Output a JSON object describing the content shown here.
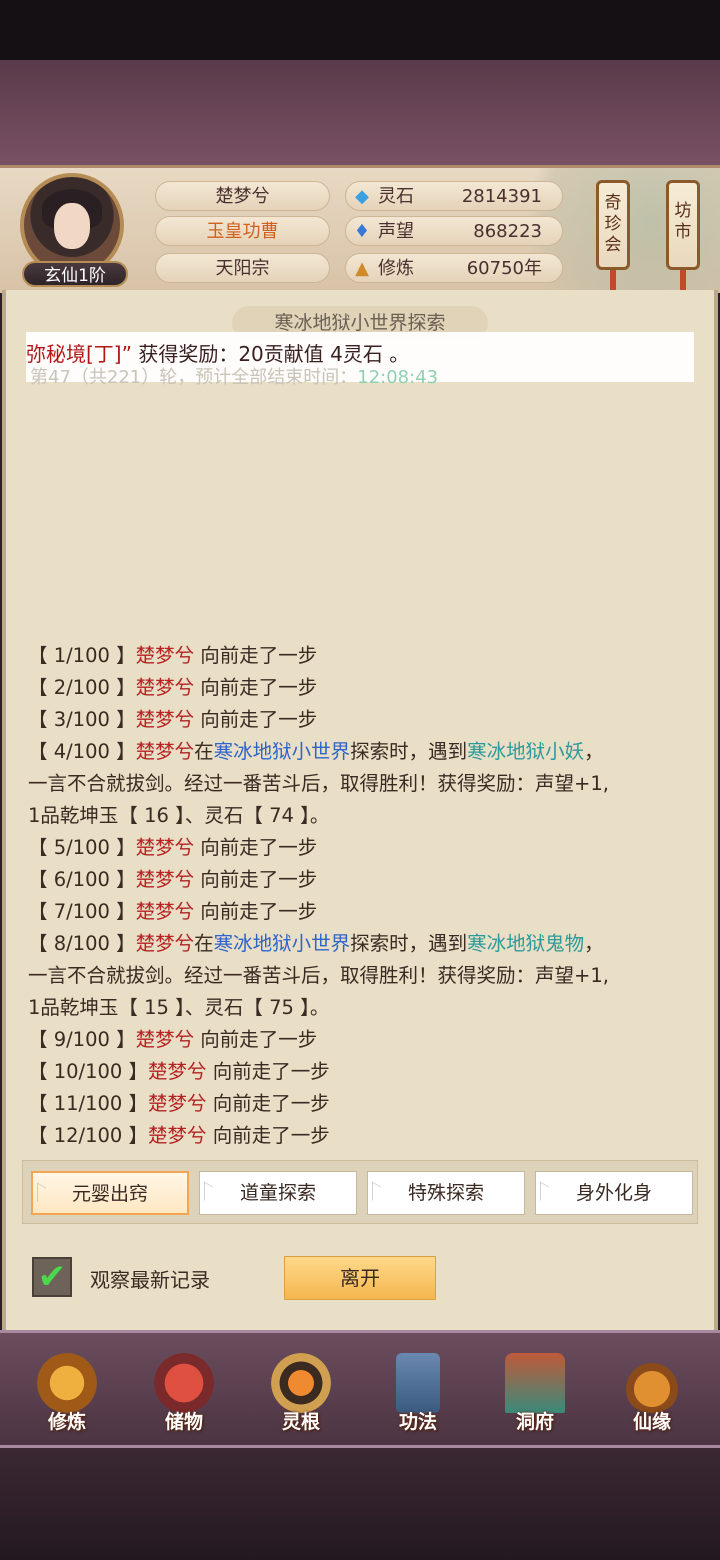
{
  "player": {
    "name": "楚梦兮",
    "title": "玉皇功曹",
    "sect": "天阳宗",
    "rank": "玄仙1阶"
  },
  "resources": [
    {
      "icon": "spirit-stone-icon",
      "label": "灵石",
      "value": "2814391"
    },
    {
      "icon": "reputation-icon",
      "label": "声望",
      "value": "868223"
    },
    {
      "icon": "cultivation-icon",
      "label": "修炼",
      "value": "60750年"
    }
  ],
  "side_buttons": {
    "treasure": "奇珍会",
    "market": "坊市"
  },
  "panel": {
    "title": "寒冰地狱小世界探索",
    "banner_prefix": "弥秘境[丁]”",
    "banner_suffix": " 获得奖励：20贡献值 4灵石 。",
    "round_text": "第47（共221）轮，预计全部结束时间：",
    "round_time": "12:08:43"
  },
  "log": {
    "l1": {
      "step": "【 1/100 】",
      "name": "楚梦兮",
      "action": " 向前走了一步"
    },
    "l2": {
      "step": "【 2/100 】",
      "name": "楚梦兮",
      "action": " 向前走了一步"
    },
    "l3": {
      "step": "【 3/100 】",
      "name": "楚梦兮",
      "action": " 向前走了一步"
    },
    "l4": {
      "step": "【 4/100 】",
      "name": "楚梦兮",
      "mid1": "在",
      "place": "寒冰地狱小世界",
      "mid2": "探索时，遇到",
      "monster": "寒冰地狱小妖",
      "end": "，"
    },
    "l4b": "一言不合就拔剑。经过一番苦斗后，取得胜利！获得奖励：声望+1,",
    "l4c": "1品乾坤玉【 16 】、灵石【 74 】。",
    "l5": {
      "step": "【 5/100 】",
      "name": "楚梦兮",
      "action": " 向前走了一步"
    },
    "l6": {
      "step": "【 6/100 】",
      "name": "楚梦兮",
      "action": " 向前走了一步"
    },
    "l7": {
      "step": "【 7/100 】",
      "name": "楚梦兮",
      "action": " 向前走了一步"
    },
    "l8": {
      "step": "【 8/100 】",
      "name": "楚梦兮",
      "mid1": "在",
      "place": "寒冰地狱小世界",
      "mid2": "探索时，遇到",
      "monster": "寒冰地狱鬼物",
      "end": "，"
    },
    "l8b": "一言不合就拔剑。经过一番苦斗后，取得胜利！获得奖励：声望+1,",
    "l8c": "1品乾坤玉【 15 】、灵石【 75 】。",
    "l9": {
      "step": "【 9/100 】",
      "name": "楚梦兮",
      "action": " 向前走了一步"
    },
    "l10": {
      "step": "【 10/100 】",
      "name": "楚梦兮",
      "action": " 向前走了一步"
    },
    "l11": {
      "step": "【 11/100 】",
      "name": "楚梦兮",
      "action": " 向前走了一步"
    },
    "l12": {
      "step": "【 12/100 】",
      "name": "楚梦兮",
      "action": " 向前走了一步"
    }
  },
  "tabs": [
    "元婴出窍",
    "道童探索",
    "特殊探索",
    "身外化身"
  ],
  "controls": {
    "watch_label": "观察最新记录",
    "watch_checked": true,
    "leave_label": "离开"
  },
  "nav": [
    "修炼",
    "储物",
    "灵根",
    "功法",
    "洞府",
    "仙缘"
  ],
  "colors": {
    "accent": "#f4b74f",
    "name_red": "#b42222",
    "place_blue": "#2f64c8",
    "monster_teal": "#2e9a9a"
  }
}
